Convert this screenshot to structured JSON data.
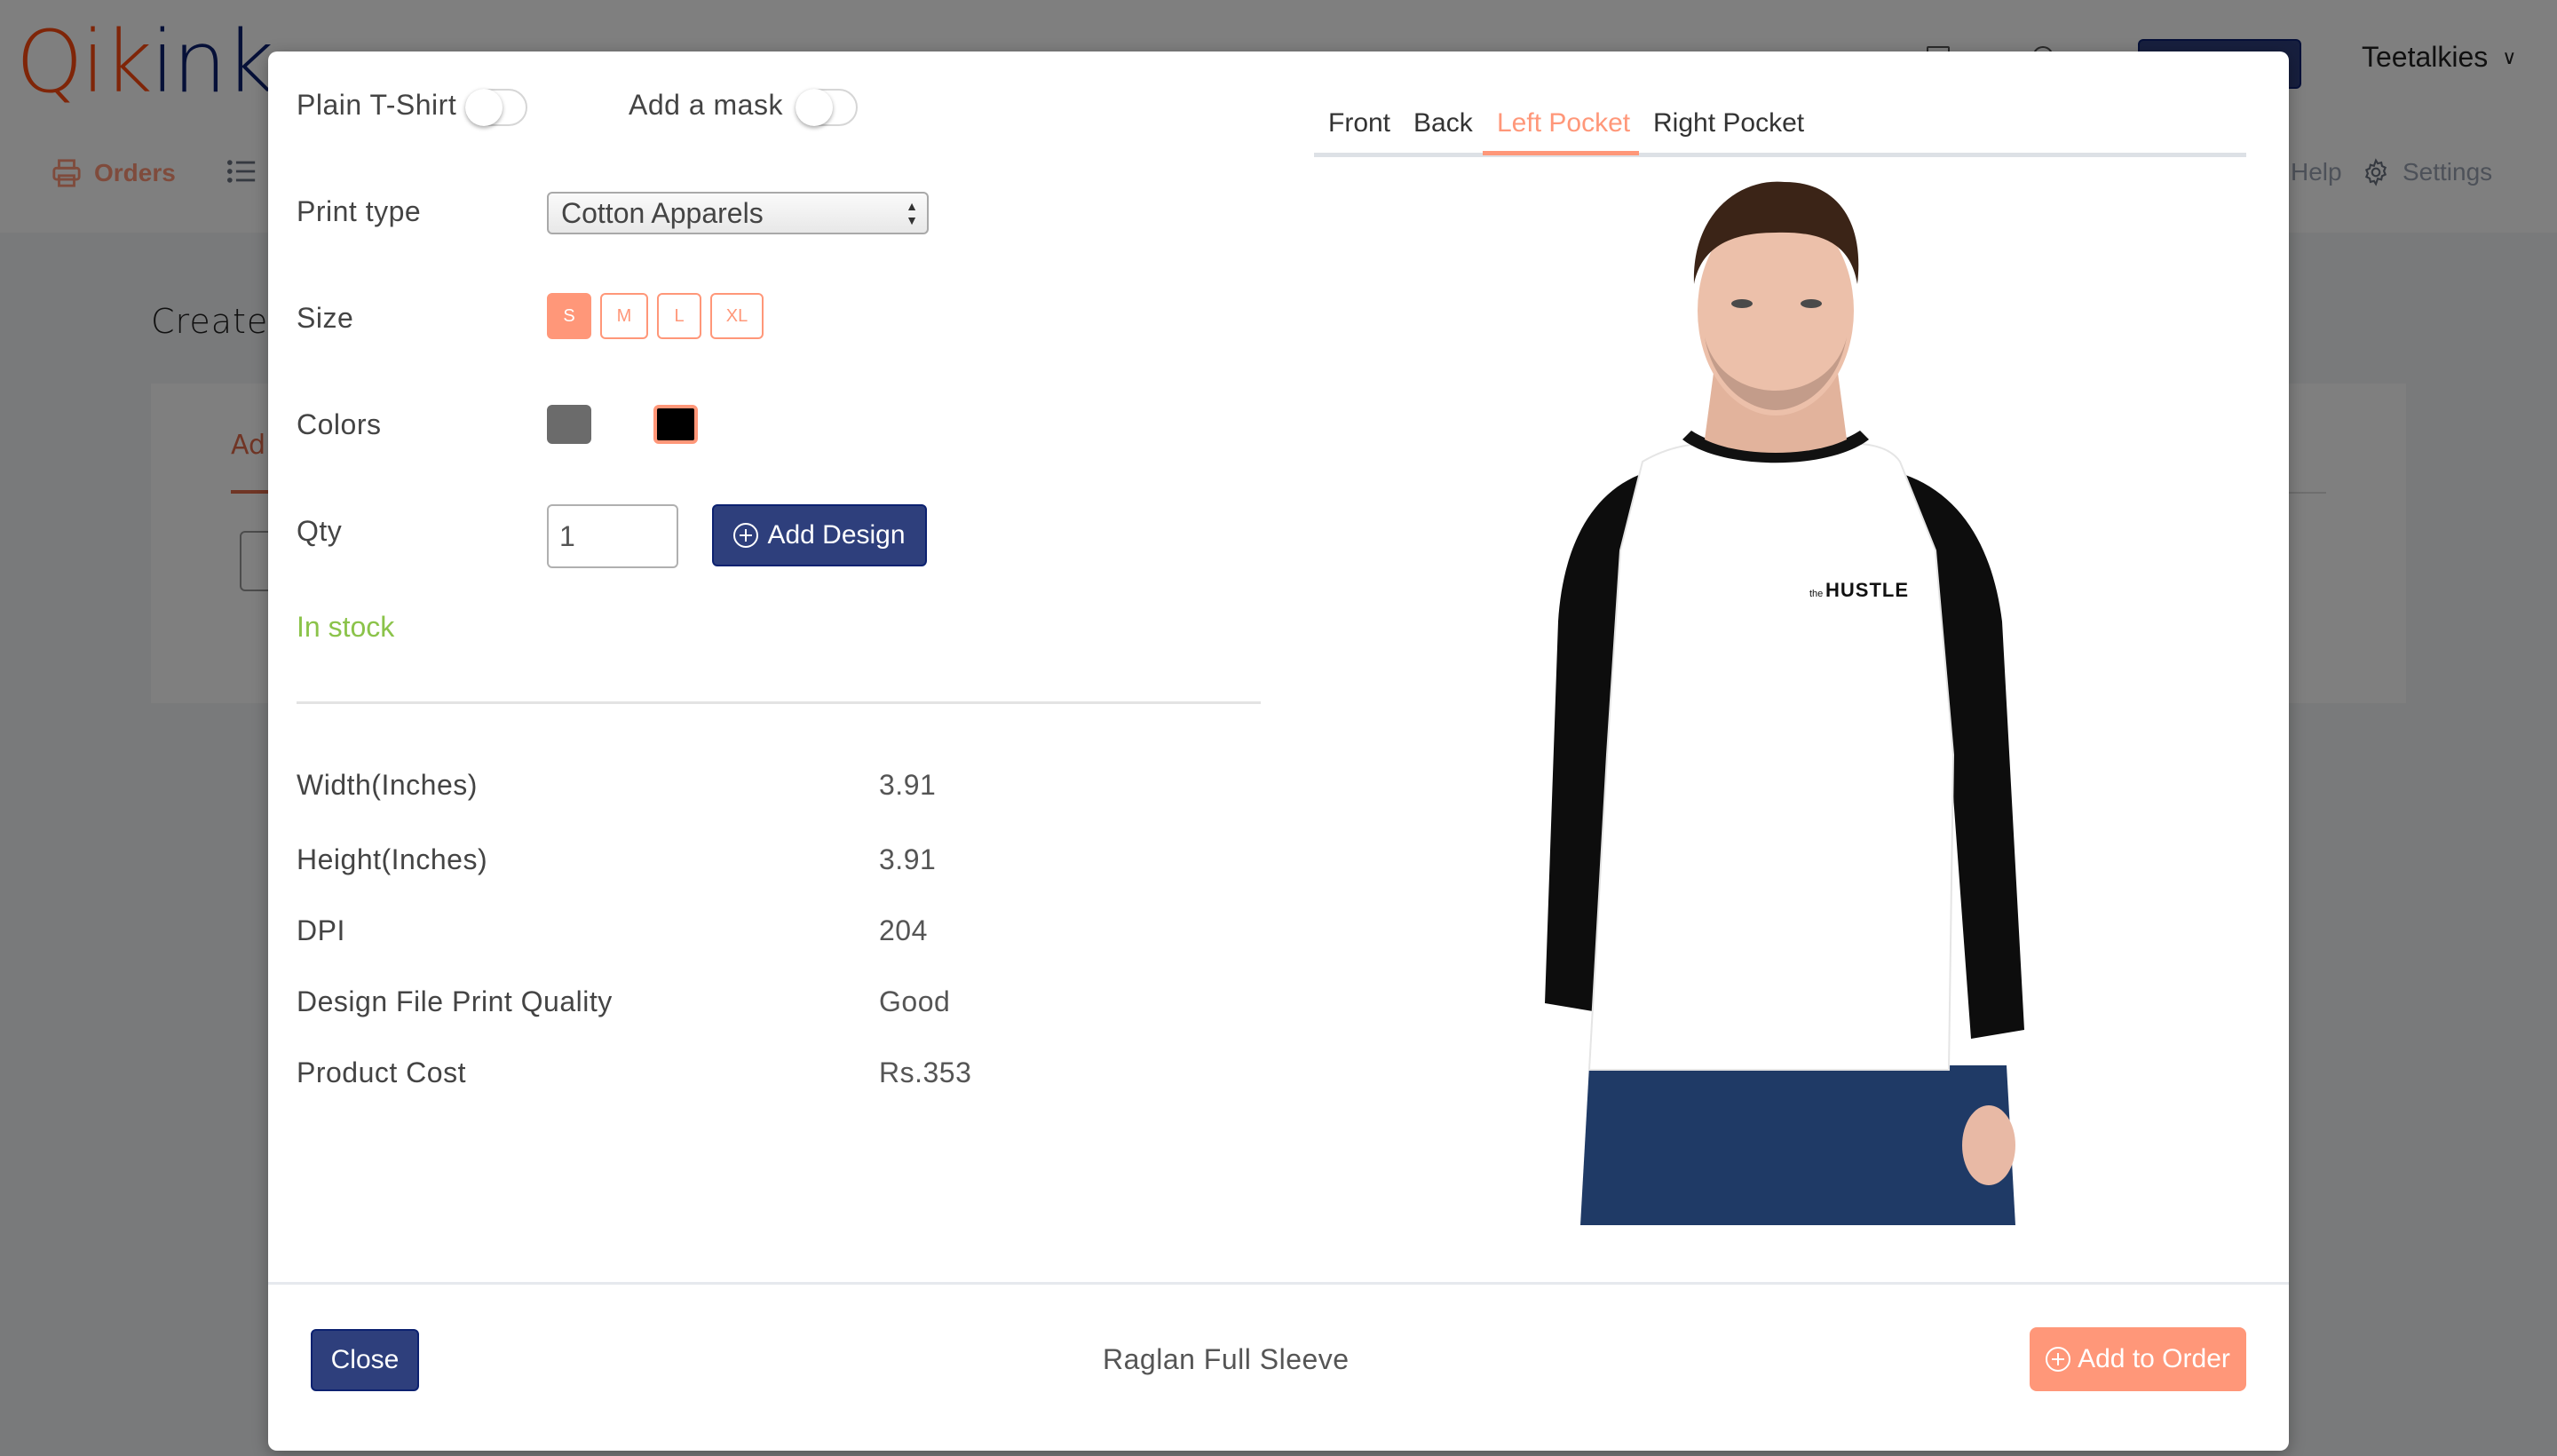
{
  "header": {
    "logo": {
      "part1": "Qik",
      "part2": "ink"
    },
    "user_name": "Teetalkies"
  },
  "nav": {
    "orders": "Orders",
    "help": "Help",
    "settings": "Settings"
  },
  "page": {
    "title": "Create",
    "card_tab": "Ad"
  },
  "modal": {
    "plain_tshirt_label": "Plain T-Shirt",
    "plain_tshirt_on": false,
    "add_mask_label": "Add a mask",
    "add_mask_on": false,
    "print_type_label": "Print type",
    "print_type_value": "Cotton Apparels",
    "size_label": "Size",
    "sizes": [
      "S",
      "M",
      "L",
      "XL"
    ],
    "selected_size": "S",
    "colors_label": "Colors",
    "colors": [
      "#6b6b6b",
      "#000000"
    ],
    "selected_color": "#000000",
    "qty_label": "Qty",
    "qty_value": "1",
    "add_design_label": "Add Design",
    "stock_status": "In stock",
    "specs": [
      {
        "label": "Width(Inches)",
        "value": "3.91"
      },
      {
        "label": "Height(Inches)",
        "value": "3.91"
      },
      {
        "label": "DPI",
        "value": "204"
      },
      {
        "label": "Design File Print Quality",
        "value": "Good"
      },
      {
        "label": "Product Cost",
        "value": "Rs.353"
      }
    ],
    "tabs": [
      "Front",
      "Back",
      "Left Pocket",
      "Right Pocket"
    ],
    "active_tab": "Left Pocket",
    "design_text": {
      "small": "the",
      "big": "HUSTLE"
    },
    "close_label": "Close",
    "product_name": "Raglan Full Sleeve",
    "add_to_order_label": "Add to Order"
  },
  "colors": {
    "accent": "#ff9779",
    "primary": "#2e3f7c",
    "success": "#8bc34a",
    "logo_orange": "#ff4a11",
    "logo_navy": "#0c2170"
  }
}
